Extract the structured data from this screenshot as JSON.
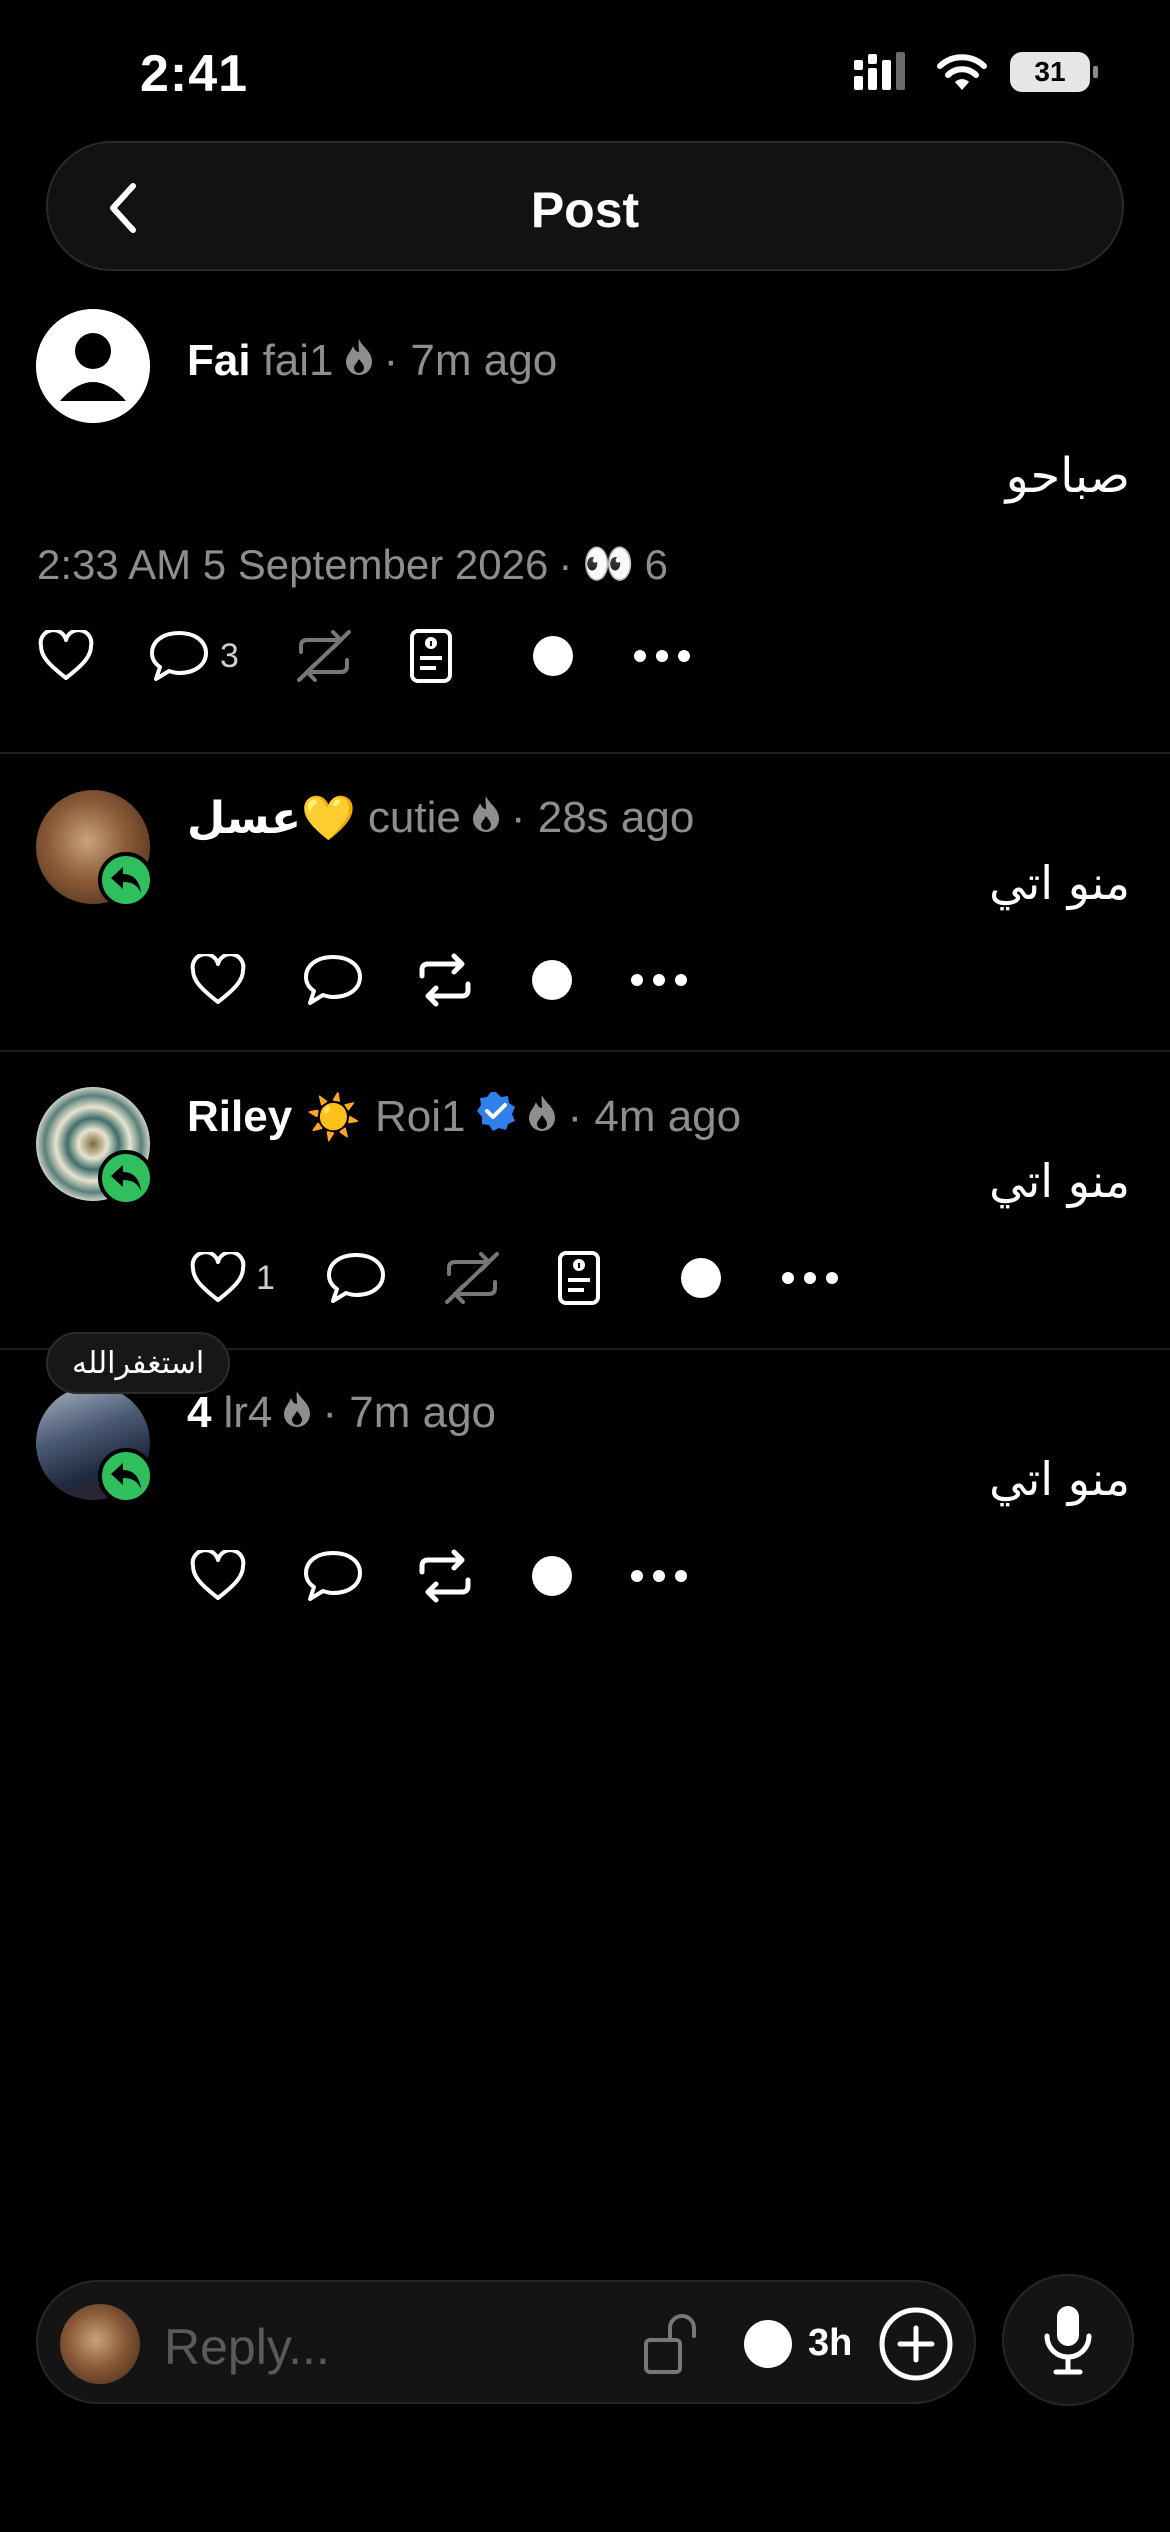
{
  "status_bar": {
    "time": "2:41",
    "battery": "31"
  },
  "header": {
    "title": "Post"
  },
  "post": {
    "name": "Fai",
    "handle": "fai1",
    "time": "· 7m ago",
    "text": "صباحو",
    "date": "2:33 AM 5 September 2026",
    "views_sep": "·",
    "views_emoji": "👀",
    "views": "6",
    "comments": "3"
  },
  "replies": [
    {
      "name": "عسل💛",
      "handle": "cutie",
      "time": "· 28s ago",
      "text": "منو اتي"
    },
    {
      "name": "Riley",
      "name_emoji": "☀️",
      "handle": "Roi1",
      "time": "· 4m ago",
      "text": "منو اتي",
      "likes": "1"
    },
    {
      "name": "4",
      "handle": "lr4",
      "time": "· 7m ago",
      "text": "منو اتي"
    }
  ],
  "tooltip": {
    "text": "استغفرالله"
  },
  "composer": {
    "placeholder": "Reply...",
    "timer": "3h"
  },
  "colors": {
    "reply_badge": "#2fbf5c",
    "verified": "#2f80ed",
    "background": "#000000"
  }
}
